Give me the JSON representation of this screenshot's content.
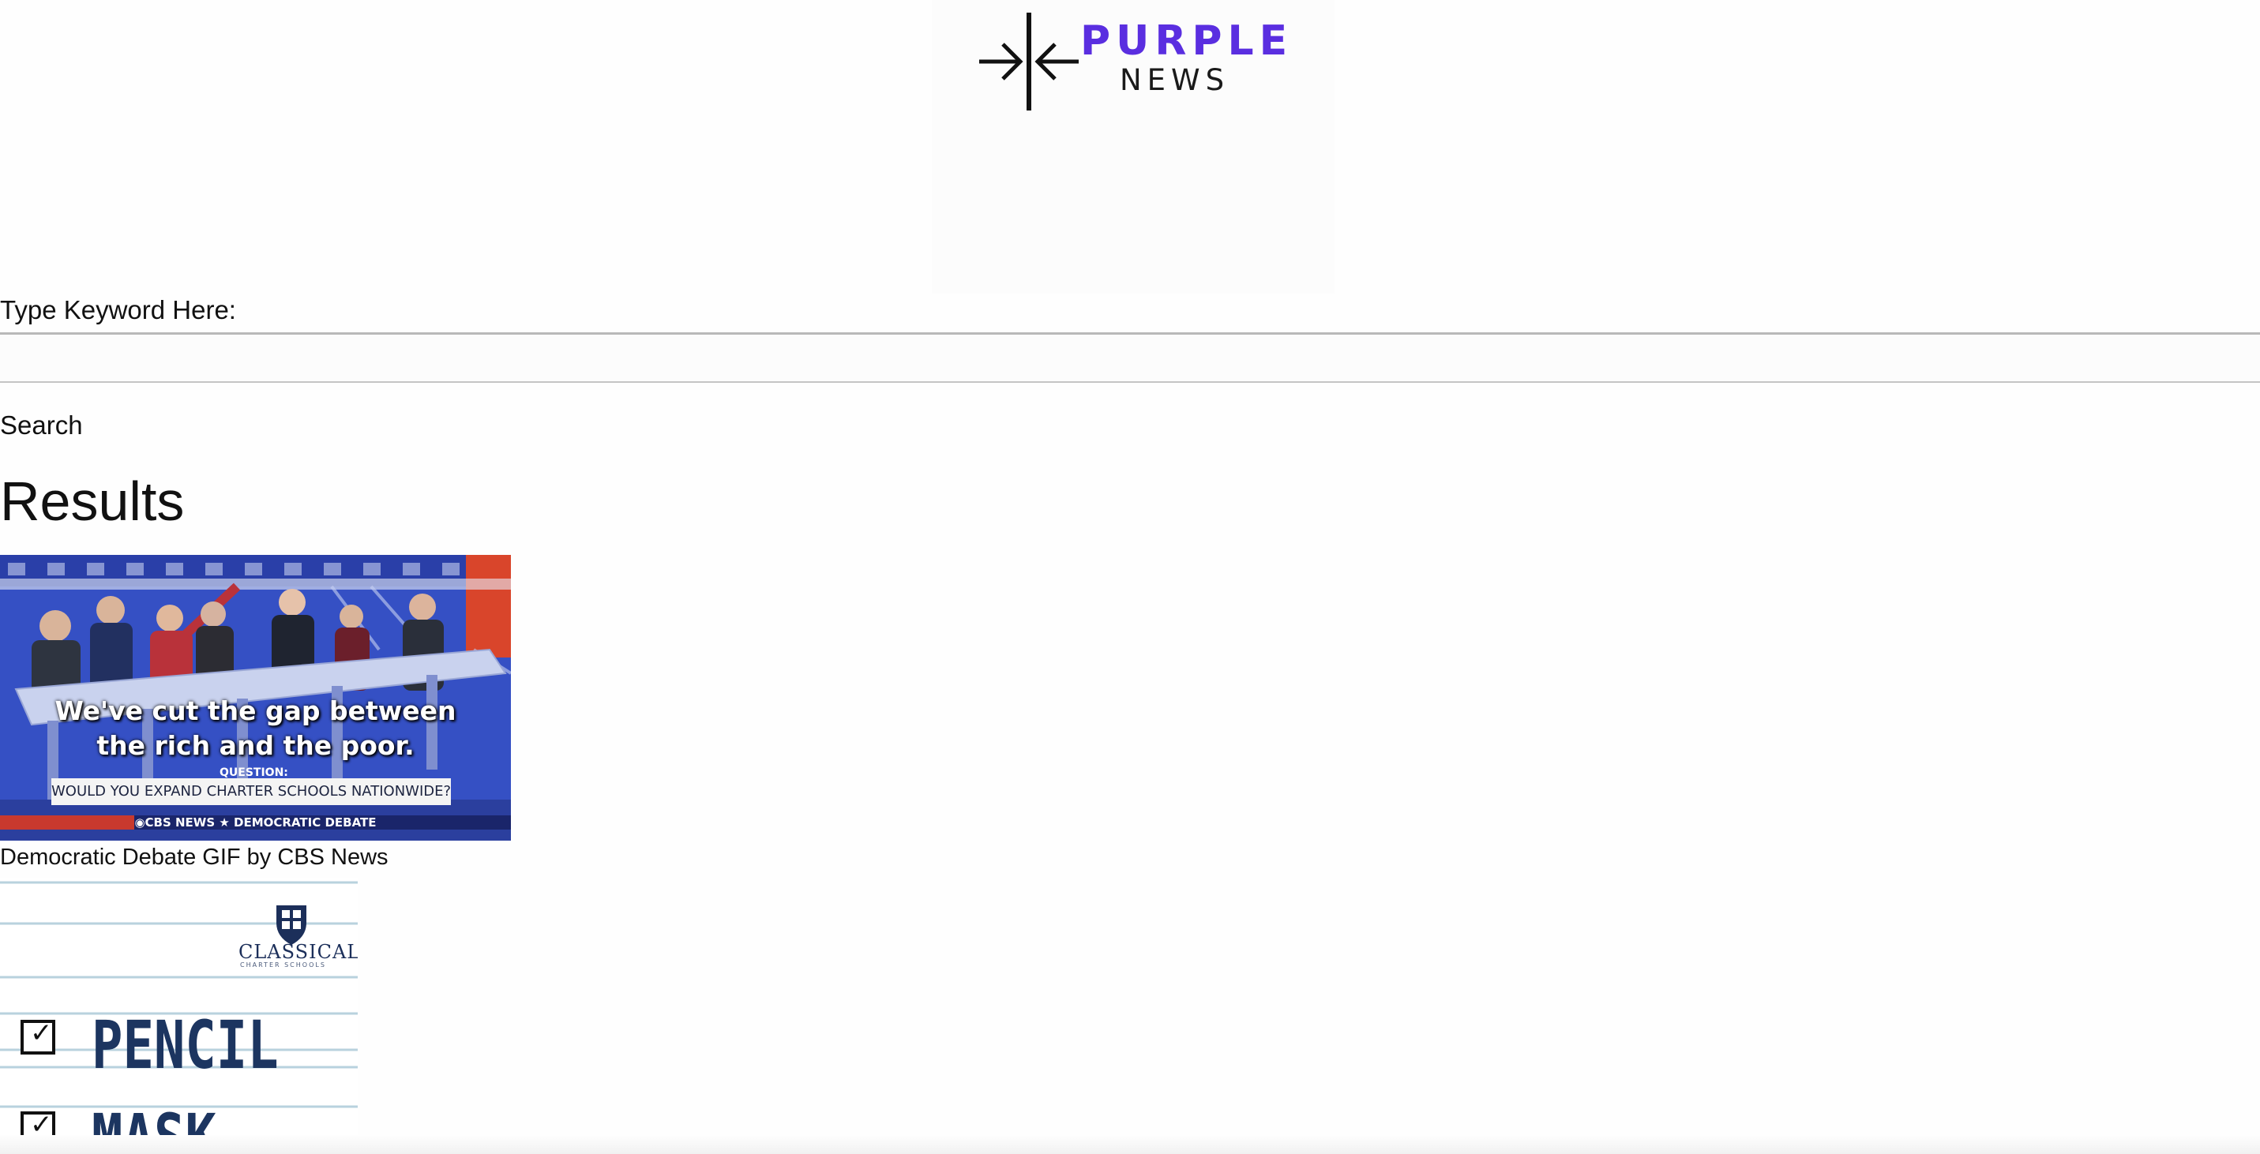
{
  "header": {
    "logo_word": "PURPLE",
    "logo_subword": "NEWS",
    "brand_color": "#5a2ee0"
  },
  "search": {
    "label": "Type Keyword Here:",
    "input_value": "",
    "button_label": "Search"
  },
  "results": {
    "title": "Results",
    "items": [
      {
        "caption": "Democratic Debate GIF by CBS News",
        "image": {
          "subtitle_line_1": "We've cut the gap between",
          "subtitle_line_2": "the rich and the poor.",
          "question_label": "QUESTION:",
          "question_text": "WOULD YOU EXPAND CHARTER SCHOOLS NATIONWIDE?",
          "network_tag": "◉CBS NEWS ★ DEMOCRATIC DEBATE"
        }
      },
      {
        "caption": "",
        "image": {
          "school_name": "CLASSICAL",
          "school_subtitle": "CHARTER SCHOOLS",
          "checklist": [
            "PENCIL",
            "MASK"
          ],
          "check_glyph": "✓"
        }
      }
    ]
  }
}
